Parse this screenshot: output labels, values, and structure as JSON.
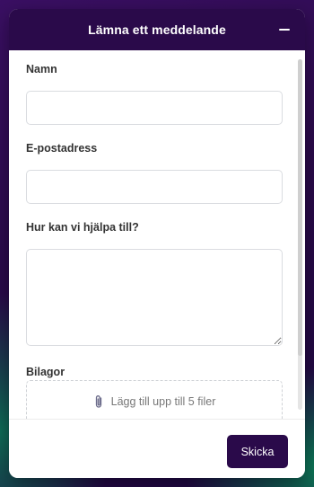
{
  "header": {
    "title": "Lämna ett meddelande",
    "minimize_icon": "minimize-icon"
  },
  "form": {
    "name_label": "Namn",
    "name_value": "",
    "email_label": "E-postadress",
    "email_value": "",
    "message_label": "Hur kan vi hjälpa till?",
    "message_value": "",
    "attachments_label": "Bilagor",
    "attachments_text": "Lägg till upp till 5 filer",
    "attachments_icon": "paperclip-icon"
  },
  "footer": {
    "send_label": "Skicka"
  },
  "colors": {
    "accent": "#2a0a4a",
    "background": "#ffffff"
  }
}
